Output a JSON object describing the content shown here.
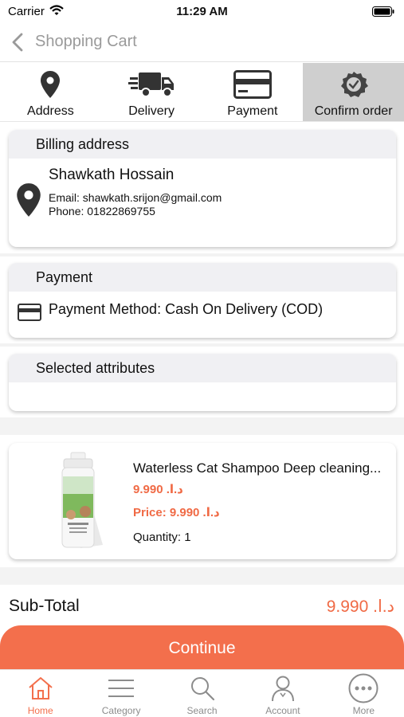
{
  "status_bar": {
    "carrier": "Carrier",
    "time": "11:29 AM"
  },
  "nav": {
    "title": "Shopping Cart"
  },
  "steps": [
    {
      "label": "Address",
      "icon": "location-pin-icon"
    },
    {
      "label": "Delivery",
      "icon": "delivery-truck-icon"
    },
    {
      "label": "Payment",
      "icon": "credit-card-icon"
    },
    {
      "label": "Confirm order",
      "icon": "confirm-badge-icon",
      "active": true
    }
  ],
  "billing": {
    "header": "Billing address",
    "name": "Shawkath Hossain",
    "email": "Email: shawkath.srijon@gmail.com",
    "phone": "Phone: 01822869755"
  },
  "payment": {
    "header": "Payment",
    "method": "Payment Method: Cash On Delivery (COD)"
  },
  "attributes": {
    "header": "Selected attributes"
  },
  "product": {
    "name": "Waterless Cat Shampoo Deep cleaning...",
    "unit_price": "9.990 .د.ا",
    "price": "Price: 9.990 .د.ا",
    "quantity": "Quantity: 1"
  },
  "summary": {
    "subtotal_label": "Sub-Total",
    "subtotal_value": "9.990 .د.ا"
  },
  "continue_label": "Continue",
  "tabs": [
    {
      "label": "Home",
      "icon": "home-icon",
      "active": true
    },
    {
      "label": "Category",
      "icon": "category-menu-icon"
    },
    {
      "label": "Search",
      "icon": "search-icon"
    },
    {
      "label": "Account",
      "icon": "account-icon"
    },
    {
      "label": "More",
      "icon": "more-icon"
    }
  ],
  "colors": {
    "accent": "#f36f4c",
    "price": "#f06a45",
    "active_step_bg": "#cfcfcf"
  }
}
